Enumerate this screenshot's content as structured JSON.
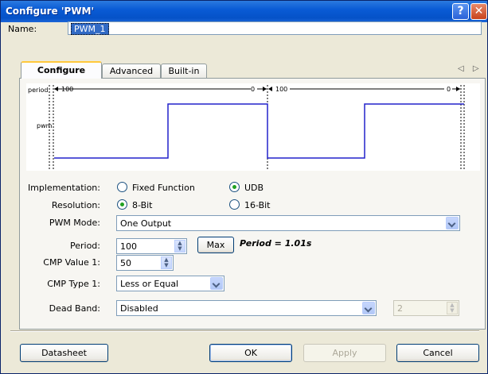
{
  "title": "Configure 'PWM'",
  "title_buttons": {
    "help": "?",
    "close": "✕"
  },
  "name": {
    "label": "Name:",
    "value": "PWM_1"
  },
  "tabs": [
    {
      "label": "Configure",
      "active": true
    },
    {
      "label": "Advanced",
      "active": false
    },
    {
      "label": "Built-in",
      "active": false
    }
  ],
  "tab_scroll": "◁ ▷",
  "waveform": {
    "row_labels": [
      "period",
      "pwm"
    ],
    "period_labels": [
      "100",
      "0",
      "100",
      "0"
    ]
  },
  "implementation": {
    "label": "Implementation:",
    "options": [
      "Fixed Function",
      "UDB"
    ],
    "selected": "UDB"
  },
  "resolution": {
    "label": "Resolution:",
    "options": [
      "8-Bit",
      "16-Bit"
    ],
    "selected": "8-Bit"
  },
  "pwm_mode": {
    "label": "PWM Mode:",
    "value": "One Output"
  },
  "period": {
    "label": "Period:",
    "value": "100",
    "max_label": "Max",
    "computed": "Period = 1.01s"
  },
  "cmp_value_1": {
    "label": "CMP Value 1:",
    "value": "50"
  },
  "cmp_type_1": {
    "label": "CMP Type 1:",
    "value": "Less or Equal"
  },
  "dead_band": {
    "label": "Dead Band:",
    "value": "Disabled",
    "count": "2"
  },
  "buttons": {
    "datasheet": "Datasheet",
    "ok": "OK",
    "apply": "Apply",
    "cancel": "Cancel"
  },
  "colors": {
    "titlebar": "#0552c8",
    "waveform": "#2222cc",
    "radio_selected": "#21a121"
  }
}
